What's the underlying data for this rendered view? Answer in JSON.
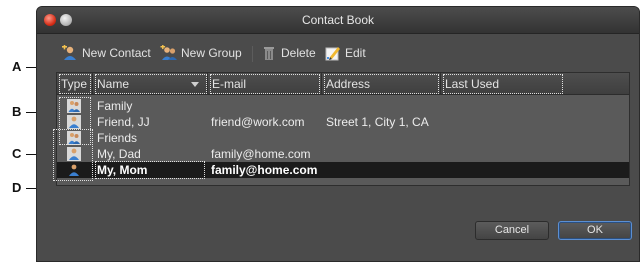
{
  "callouts": [
    "A",
    "B",
    "C",
    "D"
  ],
  "window": {
    "title": "Contact Book"
  },
  "toolbar": {
    "new_contact": "New Contact",
    "new_group": "New Group",
    "delete": "Delete",
    "edit": "Edit"
  },
  "table": {
    "columns": [
      "Type",
      "Name",
      "E-mail",
      "Address",
      "Last Used"
    ],
    "rows": [
      {
        "type": "group",
        "name": "Family",
        "email": "",
        "address": ""
      },
      {
        "type": "person",
        "name": "Friend, JJ",
        "email": "friend@work.com",
        "address": "Street 1, City 1, CA"
      },
      {
        "type": "group",
        "name": "Friends",
        "email": "",
        "address": ""
      },
      {
        "type": "person",
        "name": "My, Dad",
        "email": "family@home.com",
        "address": ""
      },
      {
        "type": "person",
        "name": "My, Mom",
        "email": "family@home.com",
        "address": "",
        "selected": true
      }
    ]
  },
  "buttons": {
    "cancel": "Cancel",
    "ok": "OK"
  },
  "icons": {
    "new_contact": "new-contact-icon",
    "new_group": "new-group-icon",
    "delete": "trash-icon",
    "edit": "edit-pencil-icon"
  },
  "colors": {
    "window_bg": "#4b4b4b",
    "ok_border": "#5b8fd3",
    "selected_row": "#1b1b1b"
  }
}
